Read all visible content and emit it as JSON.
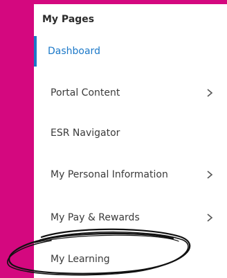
{
  "page": {
    "background_color": "#d4087f"
  },
  "nav": {
    "title": "My Pages",
    "items": [
      {
        "label": "Dashboard",
        "active": true,
        "has_chevron": false
      },
      {
        "label": "Portal Content",
        "active": false,
        "has_chevron": true
      },
      {
        "label": "ESR Navigator",
        "active": false,
        "has_chevron": false
      },
      {
        "label": "My Personal Information",
        "active": false,
        "has_chevron": true
      },
      {
        "label": "My Pay & Rewards",
        "active": false,
        "has_chevron": true
      },
      {
        "label": "My Learning",
        "active": false,
        "has_chevron": false
      }
    ],
    "active_color": "#1b78c8",
    "chevron_icon": "chevron-right-icon"
  }
}
